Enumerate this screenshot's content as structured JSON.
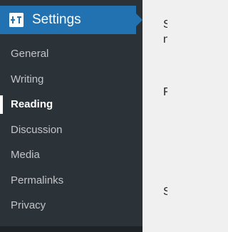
{
  "menu": {
    "icon": "settings-sliders-icon",
    "title": "Settings",
    "accent_color": "#2271b1",
    "sidebar_color": "#2c3338"
  },
  "submenu": [
    {
      "label": "General",
      "current": false
    },
    {
      "label": "Writing",
      "current": false
    },
    {
      "label": "Reading",
      "current": true
    },
    {
      "label": "Discussion",
      "current": false
    },
    {
      "label": "Media",
      "current": false
    },
    {
      "label": "Permalinks",
      "current": false
    },
    {
      "label": "Privacy",
      "current": false
    }
  ],
  "content_fragments": {
    "line1": "S",
    "line2": "n",
    "line3": "F",
    "line4": "S"
  }
}
